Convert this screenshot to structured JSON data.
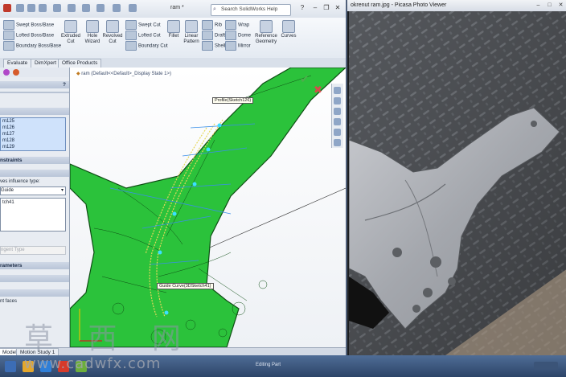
{
  "solidworks": {
    "title": "ram *",
    "search_placeholder": "Search SolidWorks Help",
    "ribbon": {
      "left_col": [
        "Swept Boss/Base",
        "Lofted Boss/Base",
        "Boundary Boss/Base"
      ],
      "extruded_cut": "Extruded Cut",
      "hole_wizard": "Hole Wizard",
      "revolved_cut": "Revolved Cut",
      "cut_col": [
        "Swept Cut",
        "Lofted Cut",
        "Boundary Cut"
      ],
      "fillet": "Fillet",
      "linear_pattern": "Linear Pattern",
      "feature_col1": [
        "Rib",
        "Draft",
        "Shell"
      ],
      "feature_col2": [
        "Wrap",
        "Dome",
        "Mirror"
      ],
      "reference_geometry": "Reference Geometry",
      "curves": "Curves"
    },
    "tabs": [
      "Evaluate",
      "DimXpert",
      "Office Products"
    ],
    "property_manager": {
      "section_profiles": [
        "m125",
        "m126",
        "m127",
        "m128",
        "m129"
      ],
      "constraints_label": "nstraints",
      "influence_label": "ves influence type:",
      "influence_value": "Guide",
      "box_item": "tch41",
      "disabled_value": "ngent Type",
      "parameters_label": "rameters",
      "faces_label": "nt faces"
    },
    "viewport": {
      "tree_label": "ram (Default<<Default>_Display State 1>)",
      "callout_profile": "Profile(Sketch126)",
      "callout_guide": "Guide Curve(3DSketch41)"
    },
    "bottom_tabs": [
      "Model",
      "Motion Study 1"
    ],
    "status_text": "Editing Part"
  },
  "picasa": {
    "title": "okrenut ram.jpg - Picasa Photo Viewer"
  },
  "watermark": {
    "chars": "草 西 网",
    "url": "www.cadwfx.com"
  },
  "colors": {
    "model_green": "#2bc23b",
    "model_edge": "#0e4d14",
    "guide_yellow": "#e6d85a",
    "selection_blue": "#3a8fe8"
  }
}
